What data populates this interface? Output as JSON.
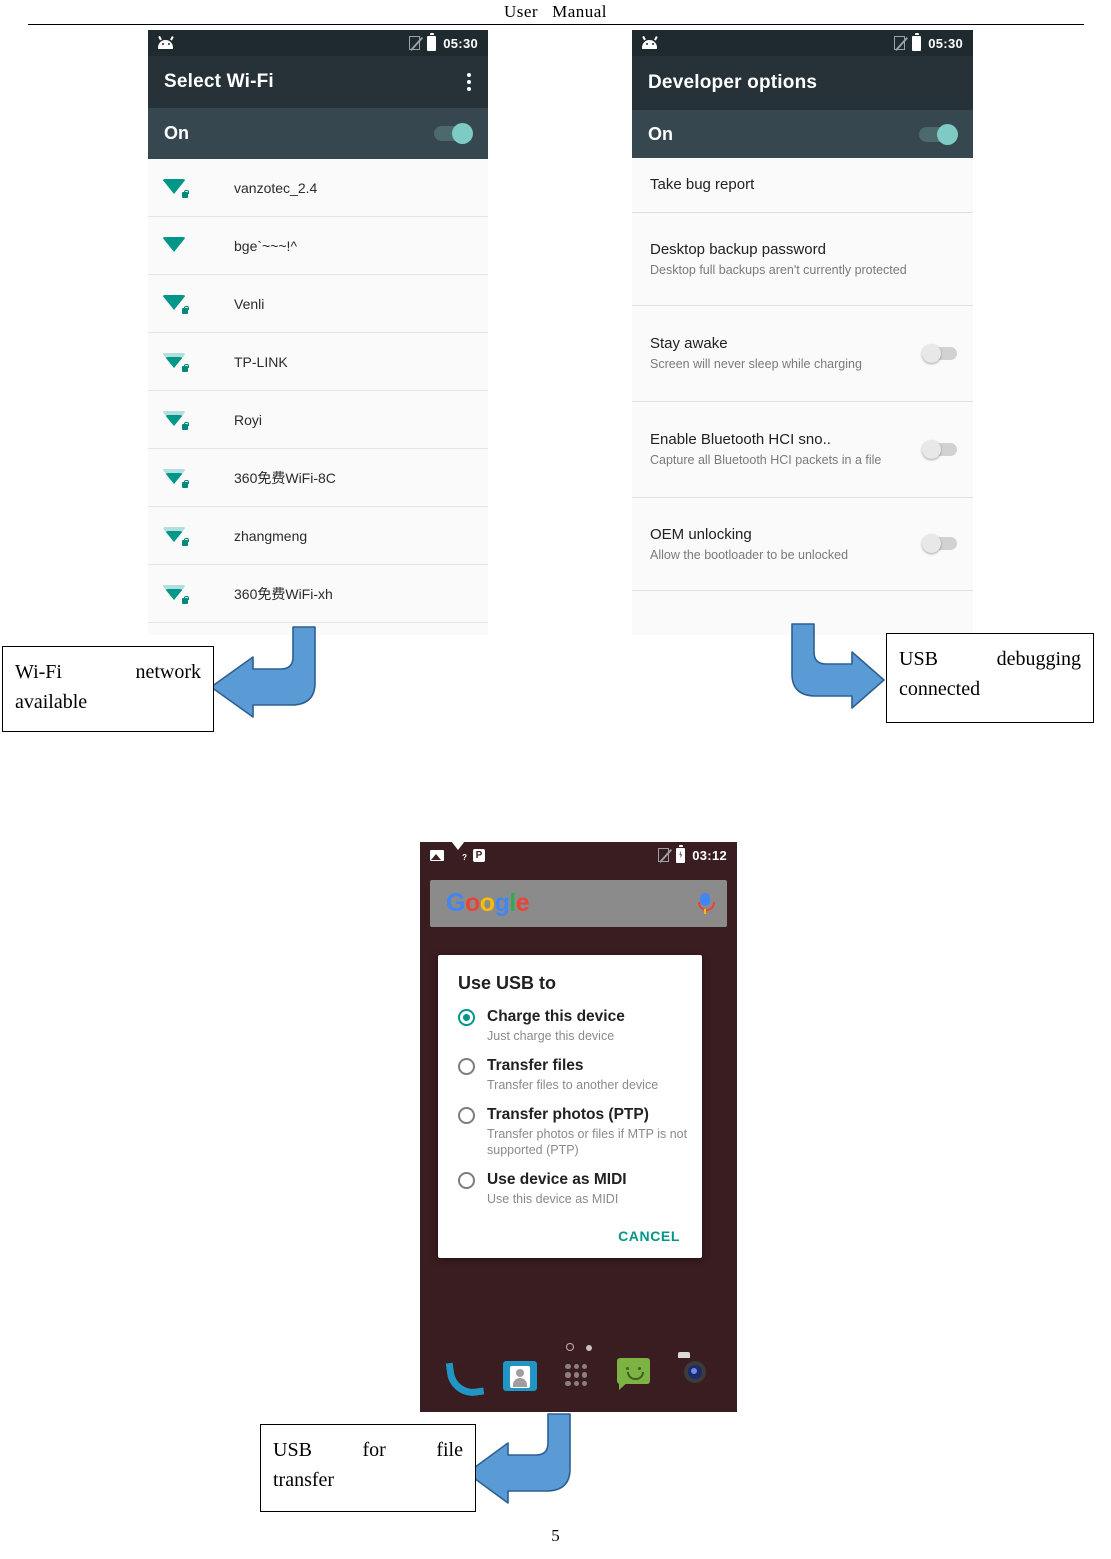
{
  "document": {
    "header_title_part1": "User",
    "header_title_part2": "Manual",
    "page_number": "5"
  },
  "wifi_screen": {
    "status_bar": {
      "time": "05:30",
      "android_icon": "android-head-icon",
      "nosim_icon": "no-sim-icon",
      "battery_icon": "battery-icon"
    },
    "app_bar": {
      "title": "Select Wi-Fi",
      "overflow_icon": "overflow-menu-icon"
    },
    "master_switch": {
      "label": "On",
      "state": "on"
    },
    "networks": [
      {
        "ssid": "vanzotec_2.4",
        "secured": true,
        "signal": 3
      },
      {
        "ssid": "bge`~~~!^",
        "secured": false,
        "signal": 3
      },
      {
        "ssid": "Venli",
        "secured": true,
        "signal": 3
      },
      {
        "ssid": "TP-LINK",
        "secured": true,
        "signal": 2
      },
      {
        "ssid": "Royi",
        "secured": true,
        "signal": 2
      },
      {
        "ssid": "360免费WiFi-8C",
        "secured": true,
        "signal": 2
      },
      {
        "ssid": "zhangmeng",
        "secured": true,
        "signal": 2
      },
      {
        "ssid": "360免费WiFi-xh",
        "secured": true,
        "signal": 2
      }
    ]
  },
  "developer_screen": {
    "status_bar": {
      "time": "05:30"
    },
    "app_bar": {
      "title": "Developer options"
    },
    "master_switch": {
      "label": "On",
      "state": "on"
    },
    "items": [
      {
        "title": "Take bug report",
        "summary": "",
        "toggle": null
      },
      {
        "title": "Desktop backup password",
        "summary": "Desktop full backups aren't currently protected",
        "toggle": null
      },
      {
        "title": "Stay awake",
        "summary": "Screen will never sleep while charging",
        "toggle": "off"
      },
      {
        "title": "Enable Bluetooth HCI sno..",
        "summary": "Capture all Bluetooth HCI packets in a file",
        "toggle": "off"
      },
      {
        "title": "OEM unlocking",
        "summary": "Allow the bootloader to be unlocked",
        "toggle": "off"
      }
    ]
  },
  "home_screen": {
    "status_bar": {
      "time": "03:12",
      "left_icons": [
        "photo-icon",
        "wifi-question-icon",
        "p-badge-icon"
      ],
      "right_icons": [
        "no-sim-icon",
        "battery-charging-icon"
      ]
    },
    "search_bar": {
      "logo": "google-logo",
      "mic_icon": "microphone-icon"
    },
    "usb_dialog": {
      "title": "Use USB to",
      "options": [
        {
          "label": "Charge this device",
          "summary": "Just charge this device",
          "selected": true
        },
        {
          "label": "Transfer files",
          "summary": "Transfer files to another device",
          "selected": false
        },
        {
          "label": "Transfer photos (PTP)",
          "summary": "Transfer photos or files if MTP is not supported (PTP)",
          "selected": false
        },
        {
          "label": "Use device as MIDI",
          "summary": "Use this device as MIDI",
          "selected": false
        }
      ],
      "cancel_label": "CANCEL"
    },
    "dock": [
      {
        "name": "phone-icon"
      },
      {
        "name": "contacts-icon"
      },
      {
        "name": "app-drawer-icon"
      },
      {
        "name": "messaging-icon"
      },
      {
        "name": "camera-icon"
      }
    ]
  },
  "callouts": [
    {
      "id": "wifi-available",
      "line1_left": "Wi-Fi",
      "line1_right": "network",
      "line2": "available"
    },
    {
      "id": "usb-debugging",
      "line1_left": "USB",
      "line1_right": "debugging",
      "line2": "connected"
    },
    {
      "id": "usb-file-transfer",
      "line1_left": "USB",
      "line1_mid": "for",
      "line1_right": "file",
      "line2": "transfer"
    }
  ],
  "colors": {
    "arrow_fill": "#5B9BD5",
    "arrow_stroke": "#2E5F94",
    "appbar": "#263238",
    "switchbar": "#37474f",
    "accent_teal": "#009688",
    "toggle_knob": "#7dcbc4"
  }
}
